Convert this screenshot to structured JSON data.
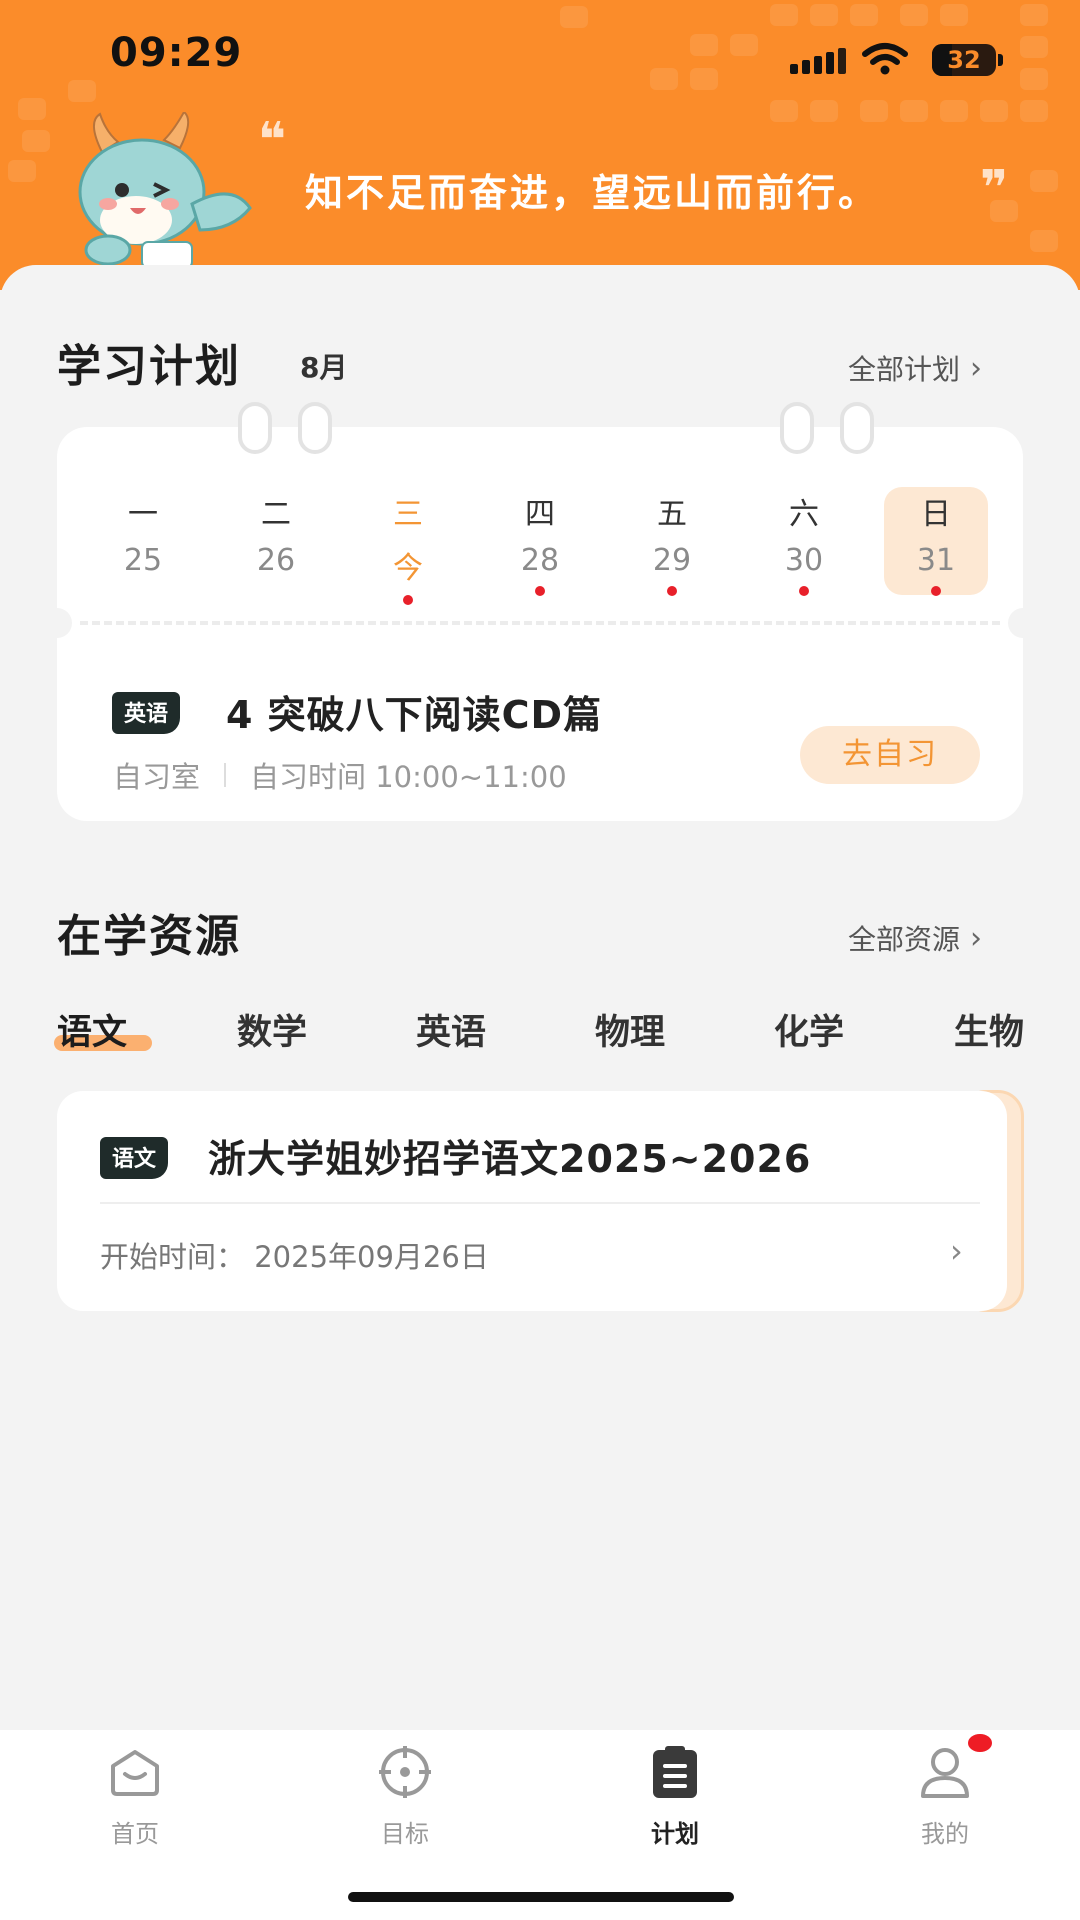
{
  "status_bar": {
    "time": "09:29",
    "battery": "32",
    "battery_level_percent": 32
  },
  "header": {
    "quote_open": "❝",
    "motto": "知不足而奋进，望远山而前行。",
    "quote_close": "❞",
    "background_color": "#fb8c2a"
  },
  "plan": {
    "title": "学习计划",
    "month": "8月",
    "all_link": "全部计划",
    "days": [
      {
        "weekday": "一",
        "date": "25",
        "dot": false
      },
      {
        "weekday": "二",
        "date": "26",
        "dot": false
      },
      {
        "weekday": "三",
        "date": "今",
        "dot": true,
        "today": true
      },
      {
        "weekday": "四",
        "date": "28",
        "dot": true
      },
      {
        "weekday": "五",
        "date": "29",
        "dot": true
      },
      {
        "weekday": "六",
        "date": "30",
        "dot": true
      },
      {
        "weekday": "日",
        "date": "31",
        "dot": true,
        "selected": true
      }
    ],
    "task": {
      "subject_tag": "英语",
      "title": "4 突破八下阅读CD篇",
      "room": "自习室",
      "time": "自习时间 10:00~11:00",
      "action": "去自习"
    }
  },
  "resources": {
    "title": "在学资源",
    "all_link": "全部资源",
    "tabs": [
      "语文",
      "数学",
      "英语",
      "物理",
      "化学",
      "生物"
    ],
    "active_tab": "语文",
    "card": {
      "subject_tag": "语文",
      "title": "浙大学姐妙招学语文2025~2026",
      "start_time": "开始时间：  2025年09月26日"
    }
  },
  "bottom_nav": {
    "items": [
      {
        "label": "首页",
        "icon": "home-icon"
      },
      {
        "label": "目标",
        "icon": "target-icon"
      },
      {
        "label": "计划",
        "icon": "clipboard-icon",
        "active": true
      },
      {
        "label": "我的",
        "icon": "user-icon",
        "badge": true
      }
    ]
  },
  "colors": {
    "accent": "#f39534",
    "dot": "#e8202a",
    "tag_bg": "#1f2b2a"
  }
}
